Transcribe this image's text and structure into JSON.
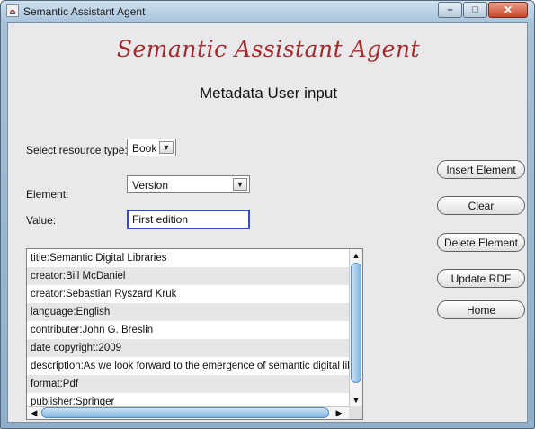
{
  "window": {
    "title": "Semantic Assistant Agent",
    "minimize_glyph": "–",
    "maximize_glyph": "□",
    "close_glyph": "✕"
  },
  "header": {
    "app_name": "Semantic Assistant Agent",
    "subtitle": "Metadata User input"
  },
  "form": {
    "resource_type_label": "Select resource type:",
    "resource_type_value": "Book",
    "element_label": "Element:",
    "element_value": "Version",
    "value_label": "Value:",
    "value_input": "First edition"
  },
  "buttons": {
    "insert": "Insert Element",
    "clear": "Clear",
    "delete": "Delete Element",
    "update": "Update RDF",
    "home": "Home"
  },
  "metadata_list": [
    "title:Semantic Digital Libraries",
    "creator:Bill McDaniel",
    "creator:Sebastian Ryszard Kruk",
    "language:English",
    "contributer:John G. Breslin",
    "date copyright:2009",
    "description:As we look forward to the emergence of semantic digital libraries",
    "format:Pdf",
    "publisher:Springer"
  ],
  "icons": {
    "arrow_down": "▼",
    "arrow_up": "▲",
    "arrow_left": "◀",
    "arrow_right": "▶"
  },
  "colors": {
    "title_accent": "#a52a2a",
    "input_border": "#3a4bb5",
    "scroll_thumb": "#7fb3e0"
  }
}
